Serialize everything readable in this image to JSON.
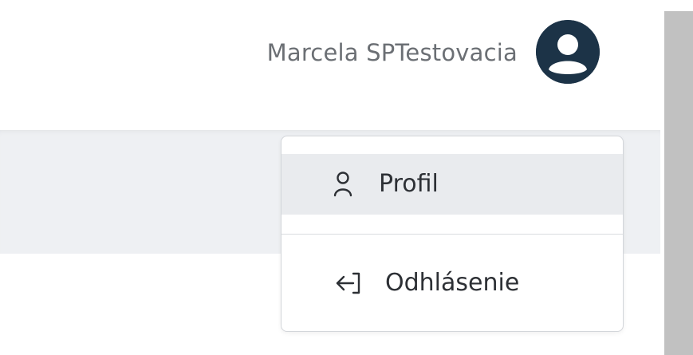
{
  "header": {
    "user_name": "Marcela SPTestovacia",
    "avatar_icon": "user-circle-icon",
    "avatar_color": "#1c3347"
  },
  "user_menu": {
    "items": [
      {
        "label": "Profil",
        "icon": "user-icon"
      },
      {
        "label": "Odhlásenie",
        "icon": "logout-icon"
      }
    ],
    "highlight_color": "#e9ebee"
  }
}
